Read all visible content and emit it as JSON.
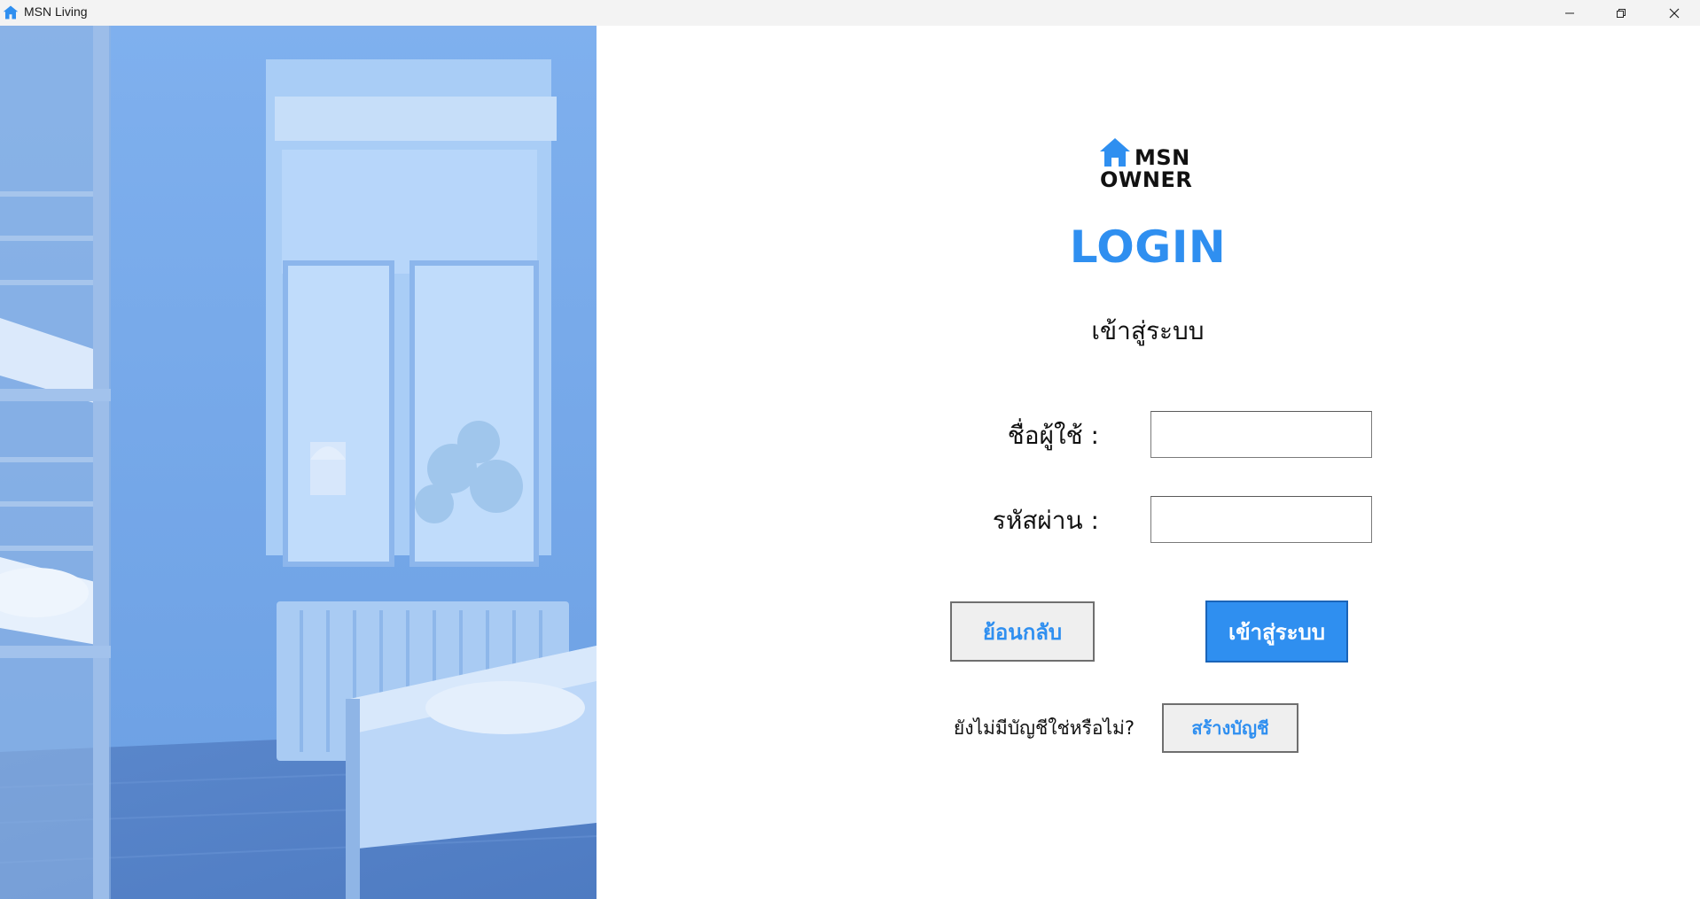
{
  "window": {
    "title": "MSN Living",
    "controls": [
      "minimize",
      "maximize",
      "close"
    ]
  },
  "logo": {
    "line1": "MSN",
    "line2": "OWNER",
    "icon": "house-icon"
  },
  "heading": "LOGIN",
  "subheading": "เข้าสู่ระบบ",
  "form": {
    "username_label": "ชื่อผู้ใช้ :",
    "username_value": "",
    "password_label": "รหัสผ่าน :",
    "password_value": ""
  },
  "buttons": {
    "back": "ย้อนกลับ",
    "login": "เข้าสู่ระบบ",
    "register": "สร้างบัญชี"
  },
  "register_prompt": "ยังไม่มีบัญชีใช่หรือไม่?",
  "colors": {
    "accent": "#2f8ff0",
    "titlebar": "#f3f3f3",
    "photo_overlay": "#6fa3e6"
  }
}
